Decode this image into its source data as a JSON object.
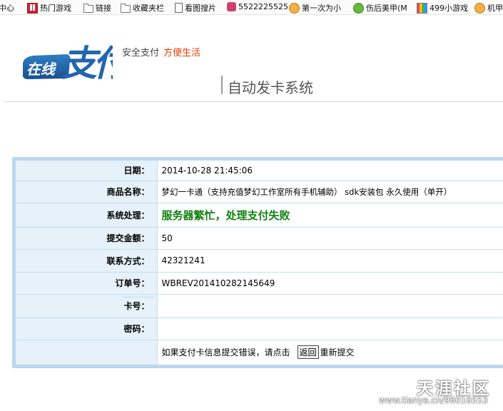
{
  "bookmarks": [
    {
      "label": "中心",
      "icon": "page-icon"
    },
    {
      "label": "热门游戏",
      "icon": "games-icon"
    },
    {
      "label": "链接",
      "icon": "folder-icon"
    },
    {
      "label": "收藏夹栏",
      "icon": "folder-icon"
    },
    {
      "label": "看图搜片",
      "icon": "page-icon"
    },
    {
      "label": "5522225525",
      "icon": "cat-icon"
    },
    {
      "label": "第一次为小",
      "icon": "smile-icon"
    },
    {
      "label": "伤后美甲(M",
      "icon": "green-icon"
    },
    {
      "label": "499小游戏",
      "icon": "multicolor-icon"
    },
    {
      "label": "机甲",
      "icon": "smile-icon"
    }
  ],
  "header": {
    "logo_text_small": "在线",
    "logo_text_big": "支付",
    "tagline_part1": "安全支付",
    "tagline_part2": "方便生活",
    "system_title": "自动发卡系统",
    "accent_color": "#e63c00"
  },
  "order": {
    "rows": {
      "date": {
        "label": "日期：",
        "value": "2014-10-28 21:45:06"
      },
      "product": {
        "label": "商品名称：",
        "value": "梦幻一卡通（支持充值梦幻工作室所有手机辅助） sdk安装包 永久使用（单开）"
      },
      "status": {
        "label": "系统处理：",
        "value": "服务器繁忙，处理支付失败"
      },
      "amount": {
        "label": "提交金额：",
        "value": "50"
      },
      "contact": {
        "label": "联系方式：",
        "value": "42321241"
      },
      "order_no": {
        "label": "订单号：",
        "value": "WBREV201410282145649"
      },
      "card_no": {
        "label": "卡号：",
        "value": ""
      },
      "password": {
        "label": "密码：",
        "value": ""
      }
    },
    "footer_text": "如果支付卡信息提交错误，请点击",
    "back_button": "返回",
    "resubmit_text": "重新提交",
    "status_color": "#128112"
  },
  "watermark": {
    "site": "天涯社区",
    "url": "www.tianya.cn/96016553"
  }
}
